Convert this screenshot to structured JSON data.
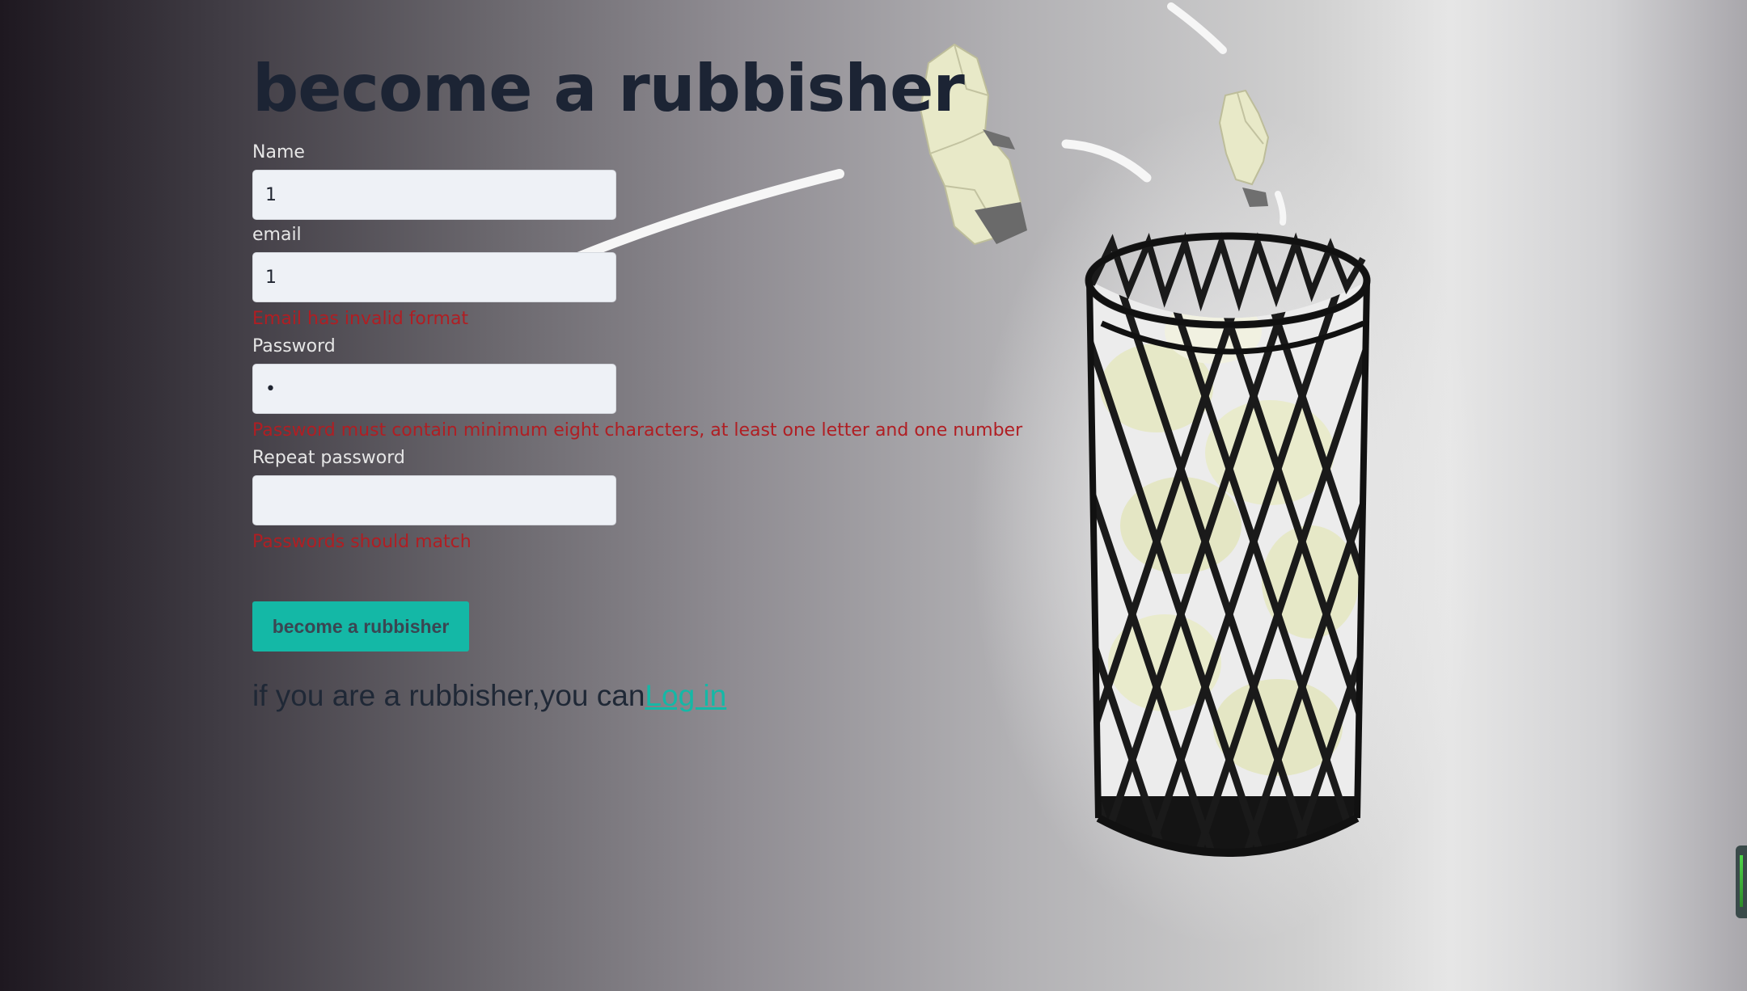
{
  "page": {
    "title": "become a rubbisher"
  },
  "form": {
    "name_label": "Name",
    "name_value": "1",
    "email_label": "email",
    "email_value": "1",
    "email_error": "Email has invalid format",
    "password_label": "Password",
    "password_value": "1",
    "password_error": "Password must contain minimum eight characters, at least one letter and one number",
    "repeat_label": "Repeat password",
    "repeat_value": "",
    "repeat_error": "Passwords should match",
    "submit_label": "become a rubbisher"
  },
  "footer": {
    "text": "if you are a rubbisher,you can",
    "link_label": "Log in"
  },
  "colors": {
    "accent": "#14b8a6",
    "error": "#b01e23",
    "heading": "#1c2434"
  },
  "illustration": {
    "icon": "trash-basket-icon"
  }
}
